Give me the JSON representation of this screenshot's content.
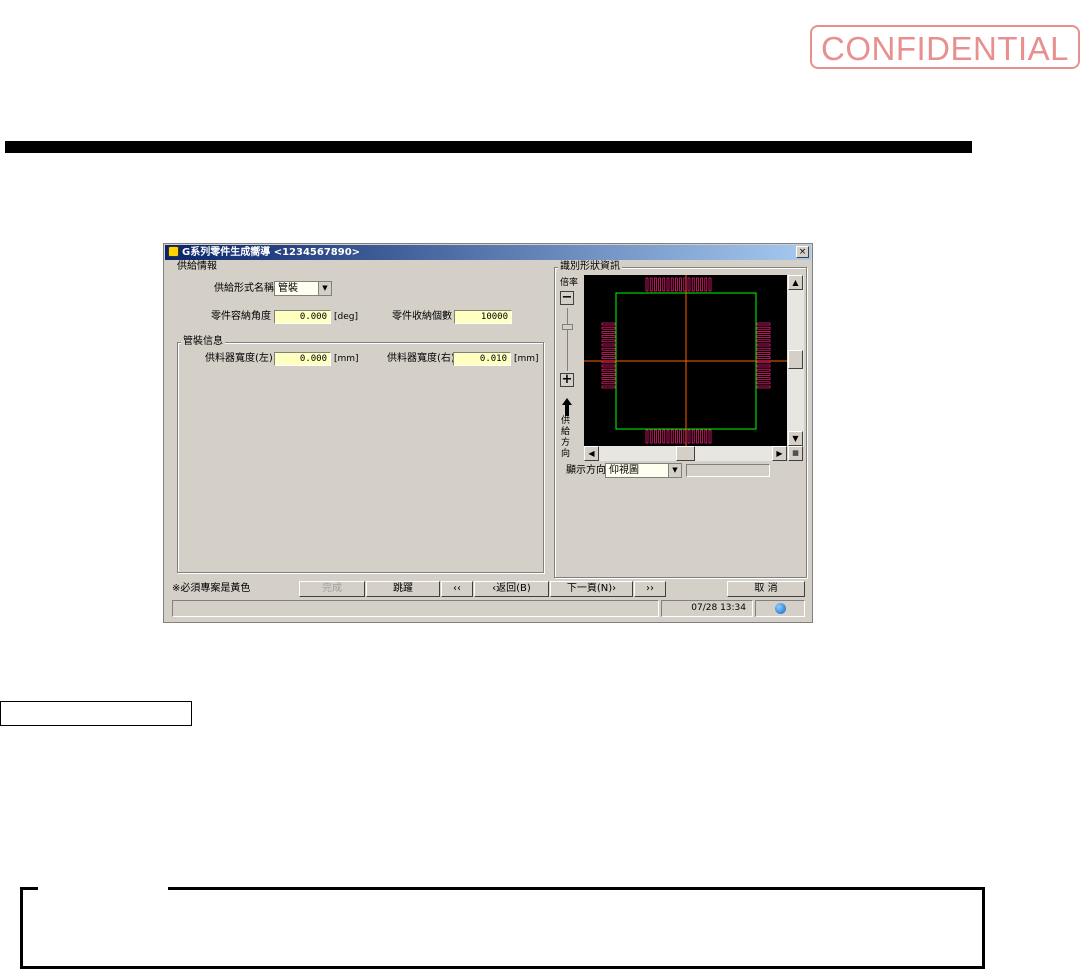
{
  "stamp": "CONFIDENTIAL",
  "window": {
    "title": "G系列零件生成嚮導 <1234567890>",
    "close_glyph": "×"
  },
  "supply": {
    "group_title": "供給情報",
    "form_label": "供給形式名稱",
    "form_value": "管裝",
    "angle_label": "零件容納角度",
    "angle_value": "0.000",
    "angle_unit": "[deg]",
    "count_label": "零件收納個數",
    "count_value": "10000"
  },
  "tube": {
    "group_title": "管裝信息",
    "left_label": "供料器寬度(左)",
    "left_value": "0.000",
    "left_unit": "[mm]",
    "right_label": "供料器寬度(右)",
    "right_value": "0.010",
    "right_unit": "[mm]"
  },
  "shape": {
    "group_title": "識別形狀資訊",
    "zoom_label": "倍率",
    "direction_label": "供給方向",
    "view_label": "顯示方向",
    "view_value": "仰視圖",
    "colors": {
      "body": "#00ff00",
      "lead": "#ff2080",
      "axis": "#ff6000",
      "background": "#000000"
    }
  },
  "footer": {
    "required_note": "※必須專案是黃色",
    "buttons": {
      "complete": "完成",
      "skip": "跳躍",
      "first": "‹‹",
      "back": "‹返回(B)",
      "next": "下一頁(N)›",
      "last": "››",
      "cancel": "取 消"
    },
    "status_time": "07/28 13:34"
  }
}
